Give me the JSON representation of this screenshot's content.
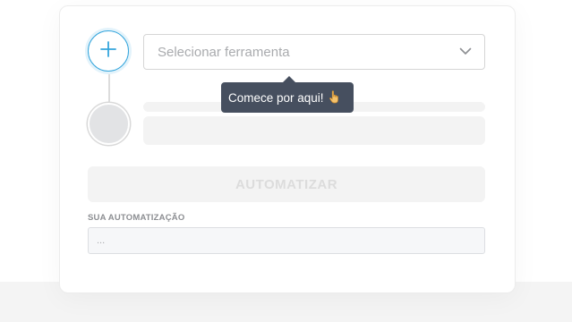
{
  "tool_select": {
    "placeholder": "Selecionar ferramenta",
    "chevron_icon": "chevron-down-icon"
  },
  "add_step": {
    "icon": "plus-icon",
    "accent_color": "#34a5dc"
  },
  "tooltip": {
    "text": "Comece por aqui!",
    "icon": "pointing-hand-icon",
    "background_color": "#464f5f"
  },
  "automate_button": {
    "label": "AUTOMATIZAR",
    "state": "disabled"
  },
  "result": {
    "label": "SUA AUTOMATIZAÇÃO",
    "value": "..."
  }
}
